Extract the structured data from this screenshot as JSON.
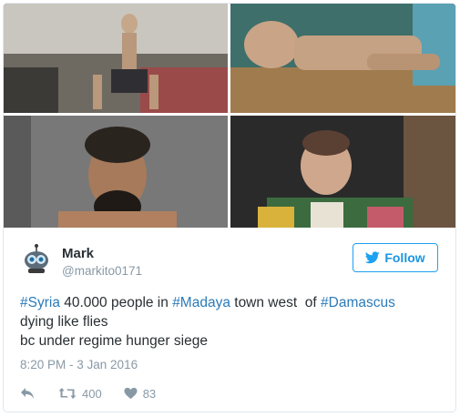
{
  "media": {
    "photos": [
      {
        "alt_icon": "photo-icon"
      },
      {
        "alt_icon": "photo-icon"
      },
      {
        "alt_icon": "photo-icon"
      },
      {
        "alt_icon": "photo-icon"
      }
    ]
  },
  "author": {
    "name": "Mark",
    "handle": "@markito0171",
    "avatar_icon": "robot-avatar-icon"
  },
  "follow_button": {
    "label": "Follow",
    "icon": "twitter-bird-icon",
    "color": "#1da1f2"
  },
  "tweet": {
    "line1": {
      "tag1": "#Syria",
      "text1": " 40.000 people in ",
      "tag2": "#Madaya",
      "text2": " town west  of ",
      "tag3": "#Damascus"
    },
    "line2": "dying like flies",
    "line3": "bc under regime hunger siege",
    "timestamp": "8:20 PM - 3 Jan 2016"
  },
  "actions": {
    "reply_icon": "reply-icon",
    "retweet_icon": "retweet-icon",
    "retweet_count": "400",
    "like_icon": "heart-icon",
    "like_count": "83"
  },
  "colors": {
    "hashtag": "#2b7bb9",
    "text": "#292f33",
    "muted": "#8899a6"
  }
}
